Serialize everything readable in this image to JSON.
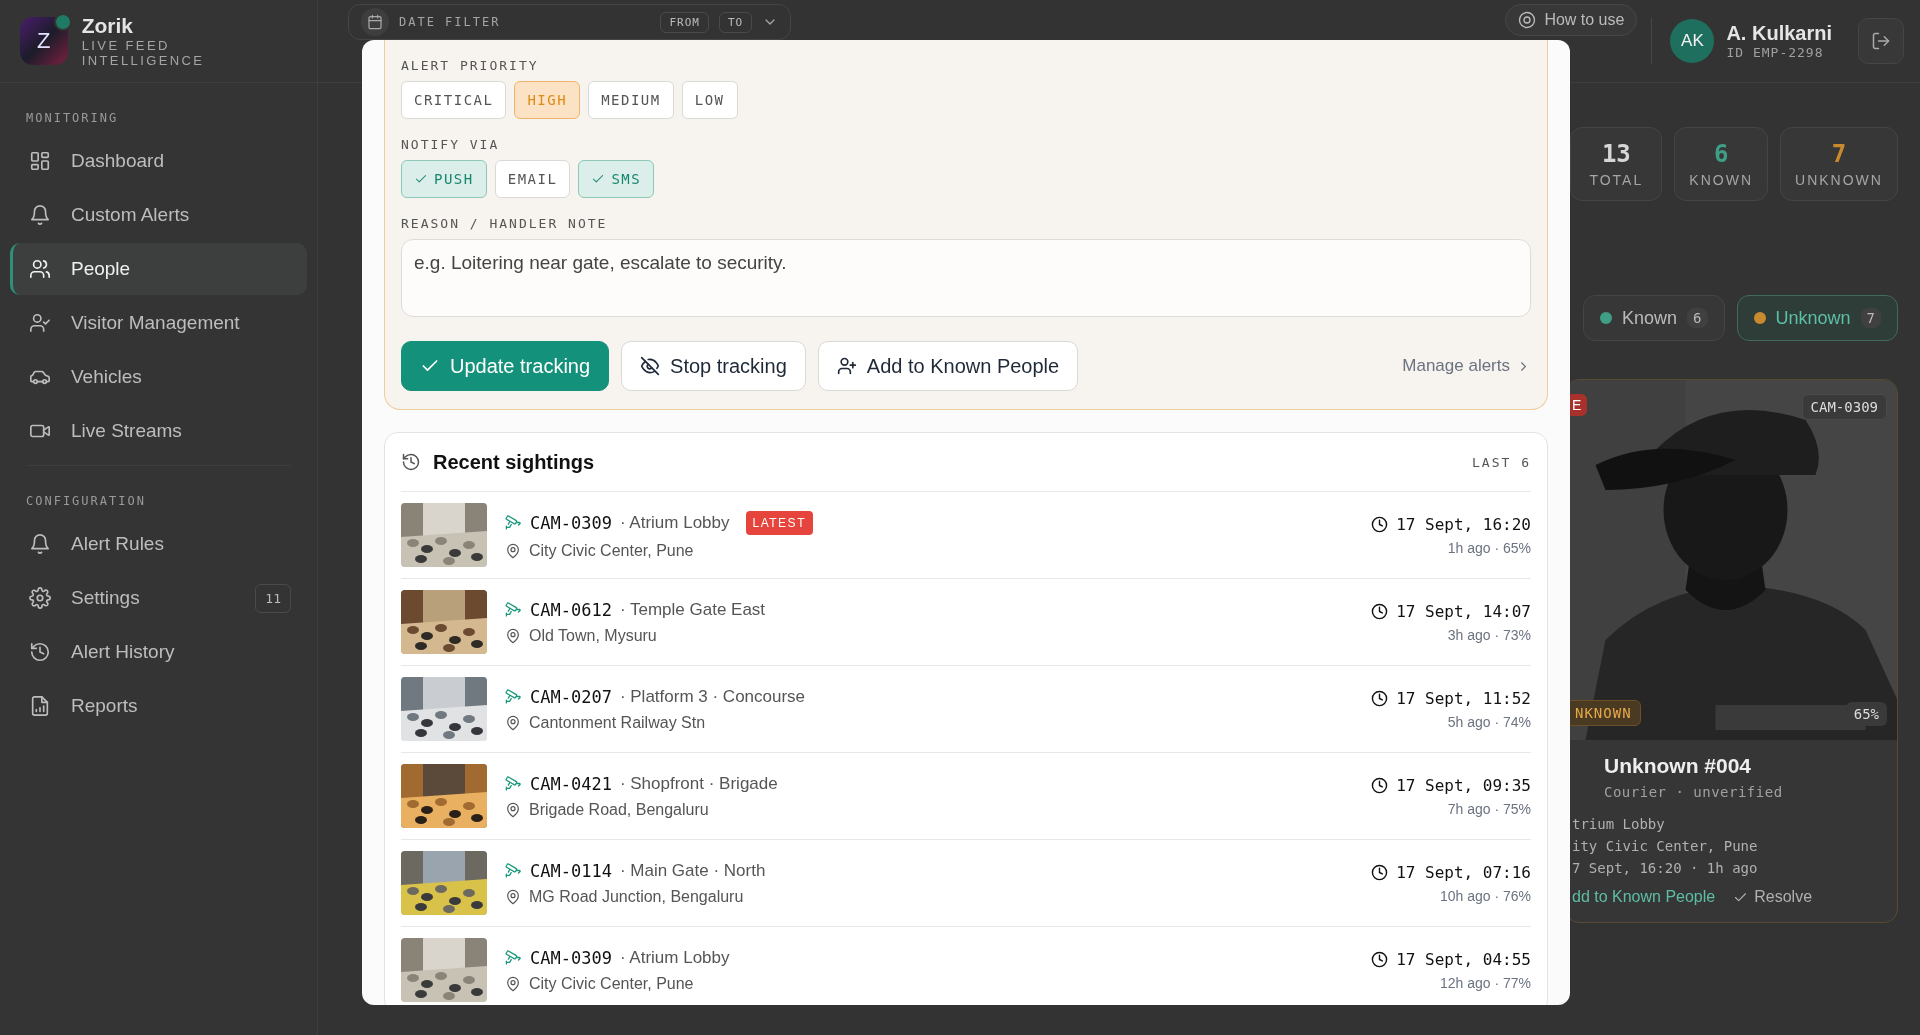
{
  "sidebar": {
    "brand": {
      "letter": "Z",
      "name": "Zorik",
      "tagline": "LIVE FEED INTELLIGENCE"
    },
    "sections": [
      {
        "title": "MONITORING",
        "items": [
          {
            "label": "Dashboard",
            "selected": false
          },
          {
            "label": "Custom Alerts",
            "selected": false
          },
          {
            "label": "People",
            "selected": true
          },
          {
            "label": "Visitor Management",
            "selected": false
          },
          {
            "label": "Vehicles",
            "selected": false
          },
          {
            "label": "Live Streams",
            "selected": false
          }
        ]
      },
      {
        "title": "CONFIGURATION",
        "items": [
          {
            "label": "Alert Rules",
            "selected": false
          },
          {
            "label": "Settings",
            "selected": false,
            "badge": "11"
          },
          {
            "label": "Alert History",
            "selected": false
          },
          {
            "label": "Reports",
            "selected": false
          }
        ]
      }
    ]
  },
  "topbar": {
    "date_filter": {
      "label": "DATE FILTER",
      "from": "FROM",
      "to": "TO"
    },
    "help": "How to use",
    "user": {
      "initials": "AK",
      "name": "A. Kulkarni",
      "id": "ID EMP-2298"
    }
  },
  "stats": [
    {
      "value": "13",
      "label": "TOTAL",
      "color": "#d6d6d6"
    },
    {
      "value": "6",
      "label": "KNOWN",
      "color": "#3f9e86"
    },
    {
      "value": "7",
      "label": "UNKNOWN",
      "color": "#c98a2e"
    }
  ],
  "filters": [
    {
      "label": "Known",
      "count": "6",
      "color": "#3f9e86",
      "selected": false
    },
    {
      "label": "Unknown",
      "count": "7",
      "color": "#c98a2e",
      "selected": true
    }
  ],
  "person_card": {
    "live_badge": "E",
    "camera": "CAM-0309",
    "status_badge": "NKNOWN",
    "confidence": "65%",
    "name": "Unknown #004",
    "subtitle": "Courier · unverified",
    "lines": [
      "trium Lobby",
      "ity Civic Center, Pune",
      "7 Sept, 16:20 · 1h ago"
    ],
    "actions": [
      {
        "label": "dd to Known People",
        "kind": "link"
      },
      {
        "label": "Resolve",
        "kind": "check"
      }
    ]
  },
  "modal": {
    "priority": {
      "label": "ALERT PRIORITY",
      "options": [
        {
          "label": "CRITICAL",
          "selected": false
        },
        {
          "label": "HIGH",
          "selected": true
        },
        {
          "label": "MEDIUM",
          "selected": false
        },
        {
          "label": "LOW",
          "selected": false
        }
      ]
    },
    "notify": {
      "label": "NOTIFY VIA",
      "options": [
        {
          "label": "PUSH",
          "checked": true
        },
        {
          "label": "EMAIL",
          "checked": false
        },
        {
          "label": "SMS",
          "checked": true
        }
      ]
    },
    "note": {
      "label": "REASON / HANDLER NOTE",
      "placeholder": "e.g. Loitering near gate, escalate to security."
    },
    "actions": [
      {
        "label": "Update tracking",
        "kind": "primary"
      },
      {
        "label": "Stop tracking",
        "kind": "secondary"
      },
      {
        "label": "Add to Known People",
        "kind": "secondary"
      }
    ],
    "manage_link": "Manage alerts",
    "sightings": {
      "title": "Recent sightings",
      "count_label": "LAST 6",
      "items": [
        {
          "camera": "CAM-0309",
          "place": "· Atrium Lobby",
          "badge": "LATEST",
          "location": "City Civic Center, Pune",
          "time": "17 Sept, 16:20",
          "meta": "1h ago · 65%"
        },
        {
          "camera": "CAM-0612",
          "place": "· Temple Gate East",
          "location": "Old Town, Mysuru",
          "time": "17 Sept, 14:07",
          "meta": "3h ago · 73%"
        },
        {
          "camera": "CAM-0207",
          "place": "· Platform 3 · Concourse",
          "location": "Cantonment Railway Stn",
          "time": "17 Sept, 11:52",
          "meta": "5h ago · 74%"
        },
        {
          "camera": "CAM-0421",
          "place": "· Shopfront · Brigade",
          "location": "Brigade Road, Bengaluru",
          "time": "17 Sept, 09:35",
          "meta": "7h ago · 75%"
        },
        {
          "camera": "CAM-0114",
          "place": "· Main Gate · North",
          "location": "MG Road Junction, Bengaluru",
          "time": "17 Sept, 07:16",
          "meta": "10h ago · 76%"
        },
        {
          "camera": "CAM-0309",
          "place": "· Atrium Lobby",
          "location": "City Civic Center, Pune",
          "time": "17 Sept, 04:55",
          "meta": "12h ago · 77%"
        }
      ]
    }
  }
}
